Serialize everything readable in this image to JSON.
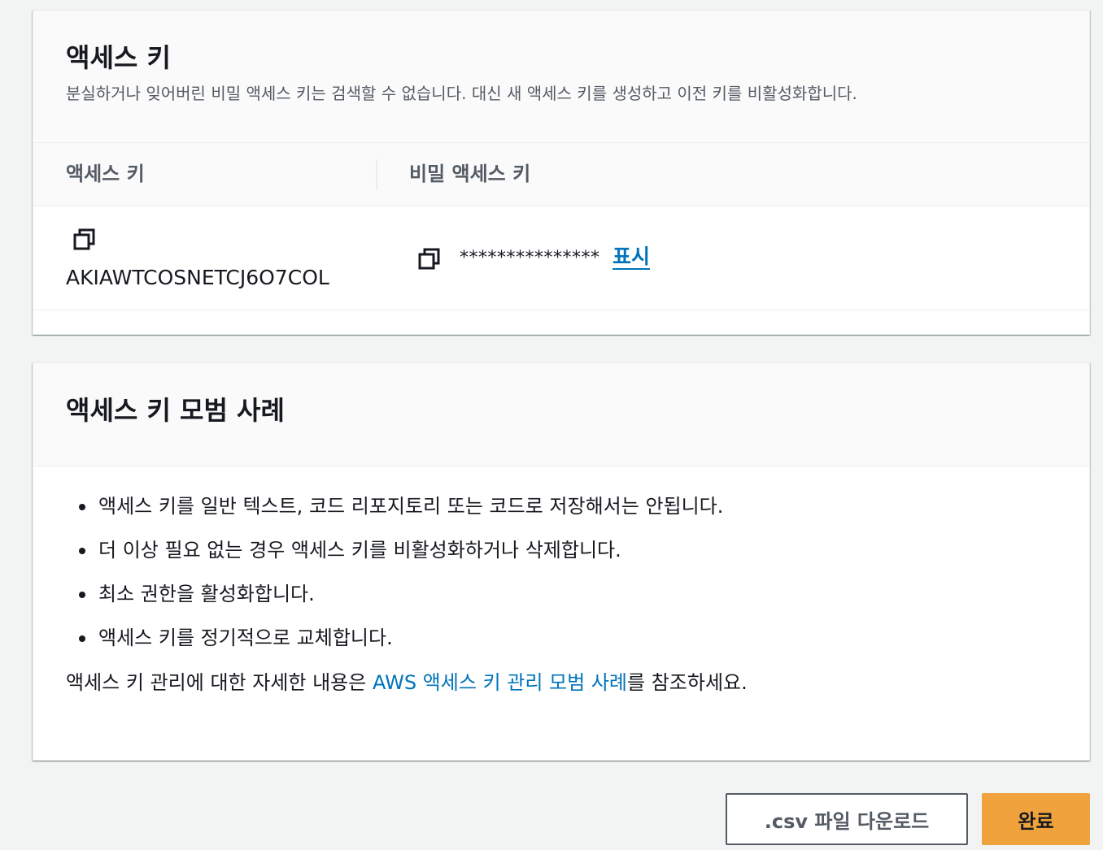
{
  "access_key_panel": {
    "title": "액세스 키",
    "description": "분실하거나 잊어버린 비밀 액세스 키는 검색할 수 없습니다. 대신 새 액세스 키를 생성하고 이전 키를 비활성화합니다.",
    "table": {
      "columns": [
        "액세스 키",
        "비밀 액세스 키"
      ],
      "row": {
        "access_key_id": "AKIAWTCOSNETCJ6O7COL",
        "secret_masked": "***************",
        "show_label": "표시"
      }
    }
  },
  "best_practices_panel": {
    "title": "액세스 키 모범 사례",
    "items": [
      "액세스 키를 일반 텍스트, 코드 리포지토리 또는 코드로 저장해서는 안됩니다.",
      "더 이상 필요 없는 경우 액세스 키를 비활성화하거나 삭제합니다.",
      "최소 권한을 활성화합니다.",
      "액세스 키를 정기적으로 교체합니다."
    ],
    "reference_prefix": "액세스 키 관리에 대한 자세한 내용은 ",
    "reference_link": "AWS 액세스 키 관리 모범 사례",
    "reference_suffix": "를 참조하세요."
  },
  "buttons": {
    "download_csv": ".csv 파일 다운로드",
    "done": "완료"
  },
  "colors": {
    "link": "#0073bb",
    "primary_button": "#f0a23c",
    "background": "#f2f3f3"
  }
}
